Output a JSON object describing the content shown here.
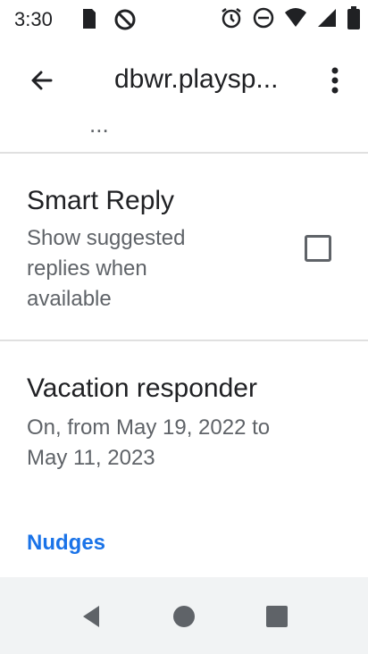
{
  "status_bar": {
    "time": "3:30"
  },
  "app_bar": {
    "title": "dbwr.playsp..."
  },
  "settings": {
    "clipped_header": "...",
    "smart_reply": {
      "title": "Smart Reply",
      "subtitle_lines": [
        "Show suggested",
        "replies when",
        "available"
      ],
      "checked": false
    },
    "vacation_responder": {
      "title": "Vacation responder",
      "subtitle_lines": [
        "On, from May 19, 2022 to",
        "May 11, 2023"
      ]
    },
    "section_nudges": "Nudges"
  },
  "colors": {
    "accent": "#1a73e8",
    "text_primary": "#202124",
    "text_secondary": "#5f6368",
    "divider": "#e0e0e0",
    "navbar_bg": "#f1f3f4"
  },
  "icons": {
    "status_left": [
      "sd-card-icon",
      "sync-disabled-icon"
    ],
    "status_right": [
      "alarm-icon",
      "do-not-disturb-icon",
      "wifi-icon",
      "signal-icon",
      "battery-icon"
    ],
    "nav": [
      "back-triangle-icon",
      "home-circle-icon",
      "recents-square-icon"
    ]
  }
}
